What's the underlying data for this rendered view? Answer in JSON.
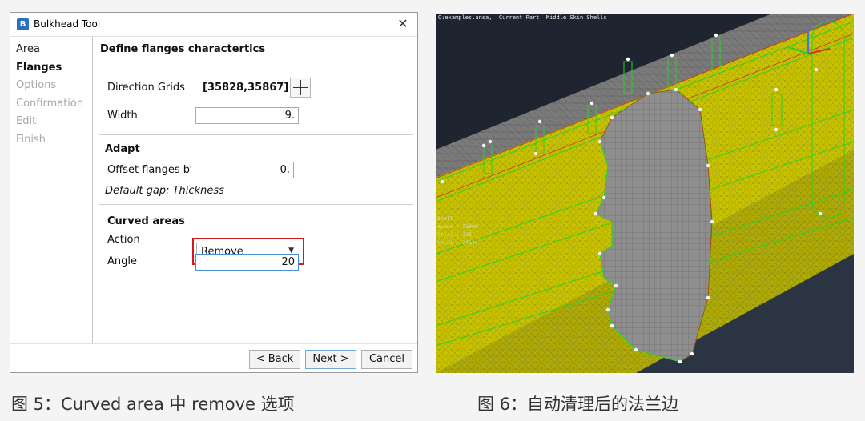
{
  "dialog": {
    "title": "Bulkhead Tool",
    "close_icon": "close-icon",
    "nav": [
      {
        "label": "Area",
        "state": "done"
      },
      {
        "label": "Flanges",
        "state": "active"
      },
      {
        "label": "Options",
        "state": "pending"
      },
      {
        "label": "Confirmation",
        "state": "pending"
      },
      {
        "label": "Edit",
        "state": "pending"
      },
      {
        "label": "Finish",
        "state": "pending"
      }
    ],
    "section_title": "Define flanges charactertics",
    "direction_grids_label": "Direction Grids",
    "direction_grids_value": "[35828,35867]",
    "width_label": "Width",
    "width_value": "9.",
    "adapt_title": "Adapt",
    "offset_label": "Offset flanges by",
    "offset_value": "0.",
    "default_gap": "Default gap: Thickness",
    "curved_title": "Curved areas",
    "action_label": "Action",
    "action_value": "Remove",
    "angle_label": "Angle",
    "angle_value": "20",
    "buttons": {
      "back": "< Back",
      "next": "Next >",
      "cancel": "Cancel"
    },
    "highlight_color": "#d4181f"
  },
  "viewport": {
    "header": "O:examples.ansa,  Current Part: Middle Skin Shells",
    "stats_title": "Shell",
    "stats": [
      {
        "label": "quads :",
        "value": "23806"
      },
      {
        "label": "trias :",
        "value": "338"
      },
      {
        "label": "total :",
        "value": "24144"
      }
    ],
    "colors": {
      "shell": "#c9c200",
      "hole": "#8a8a8a",
      "skin": "#777777",
      "edge": "#2bd12b",
      "background": "#1e2530"
    }
  },
  "captions": {
    "left": "图 5：Curved area 中 remove 选项",
    "right": "图 6：自动清理后的法兰边"
  }
}
